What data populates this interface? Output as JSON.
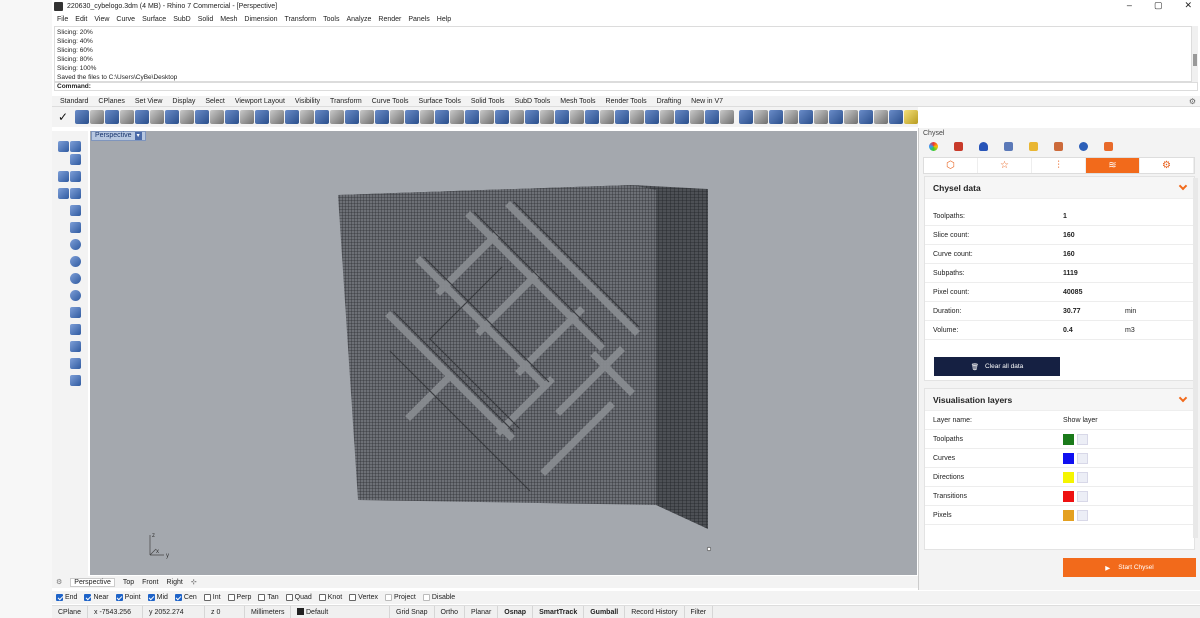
{
  "window": {
    "title": "220630_cybelogo.3dm (4 MB) - Rhino 7 Commercial - [Perspective]",
    "controls": [
      "–",
      "▢",
      "✕"
    ]
  },
  "menu": [
    "File",
    "Edit",
    "View",
    "Curve",
    "Surface",
    "SubD",
    "Solid",
    "Mesh",
    "Dimension",
    "Transform",
    "Tools",
    "Analyze",
    "Render",
    "Panels",
    "Help"
  ],
  "history": [
    "Slicing: 20%",
    "Slicing: 40%",
    "Slicing: 60%",
    "Slicing: 80%",
    "Slicing: 100%",
    "Saved the files to C:\\Users\\CyBe\\Desktop"
  ],
  "command_label": "Command:",
  "toolbar_tabs": [
    "Standard",
    "CPlanes",
    "Set View",
    "Display",
    "Select",
    "Viewport Layout",
    "Visibility",
    "Transform",
    "Curve Tools",
    "Surface Tools",
    "Solid Tools",
    "SubD Tools",
    "Mesh Tools",
    "Render Tools",
    "Drafting",
    "New in V7"
  ],
  "viewport": {
    "name": "Perspective",
    "axes": {
      "z": "z",
      "x": "x",
      "y": "y"
    }
  },
  "view_tabs": [
    "Perspective",
    "Top",
    "Front",
    "Right",
    "⊹"
  ],
  "osnaps": [
    {
      "label": "End",
      "checked": true
    },
    {
      "label": "Near",
      "checked": true
    },
    {
      "label": "Point",
      "checked": true
    },
    {
      "label": "Mid",
      "checked": true
    },
    {
      "label": "Cen",
      "checked": true
    },
    {
      "label": "Int",
      "checked": false
    },
    {
      "label": "Perp",
      "checked": false
    },
    {
      "label": "Tan",
      "checked": false
    },
    {
      "label": "Quad",
      "checked": false
    },
    {
      "label": "Knot",
      "checked": false
    },
    {
      "label": "Vertex",
      "checked": false
    },
    {
      "label": "Project",
      "checked": false
    },
    {
      "label": "Disable",
      "checked": false
    }
  ],
  "status": {
    "cplane": "CPlane",
    "x": "x -7543.256",
    "y": "y 2052.274",
    "z": "z 0",
    "units": "Millimeters",
    "layer": "Default",
    "toggles": [
      "Grid Snap",
      "Ortho",
      "Planar",
      "Osnap",
      "SmartTrack",
      "Gumball",
      "Record History",
      "Filter"
    ],
    "bold_toggles": [
      "Osnap",
      "SmartTrack",
      "Gumball"
    ]
  },
  "panel": {
    "title": "Chysel",
    "accent": "#f26a1b",
    "data_card": {
      "title": "Chysel data",
      "rows": [
        {
          "label": "Toolpaths:",
          "value": "1",
          "unit": ""
        },
        {
          "label": "Slice count:",
          "value": "160",
          "unit": ""
        },
        {
          "label": "Curve count:",
          "value": "160",
          "unit": ""
        },
        {
          "label": "Subpaths:",
          "value": "1119",
          "unit": ""
        },
        {
          "label": "Pixel count:",
          "value": "40085",
          "unit": ""
        },
        {
          "label": "Duration:",
          "value": "30.77",
          "unit": "min"
        },
        {
          "label": "Volume:",
          "value": "0.4",
          "unit": "m3"
        }
      ],
      "clear_button": "Clear all data"
    },
    "layers_card": {
      "title": "Visualisation layers",
      "header_name": "Layer name:",
      "header_show": "Show layer",
      "layers": [
        {
          "label": "Toolpaths",
          "color": "#1a7a1a"
        },
        {
          "label": "Curves",
          "color": "#1010f0"
        },
        {
          "label": "Directions",
          "color": "#f5f500"
        },
        {
          "label": "Transitions",
          "color": "#ee1111"
        },
        {
          "label": "Pixels",
          "color": "#e4a020"
        }
      ]
    },
    "start_button": "Start Chysel"
  }
}
